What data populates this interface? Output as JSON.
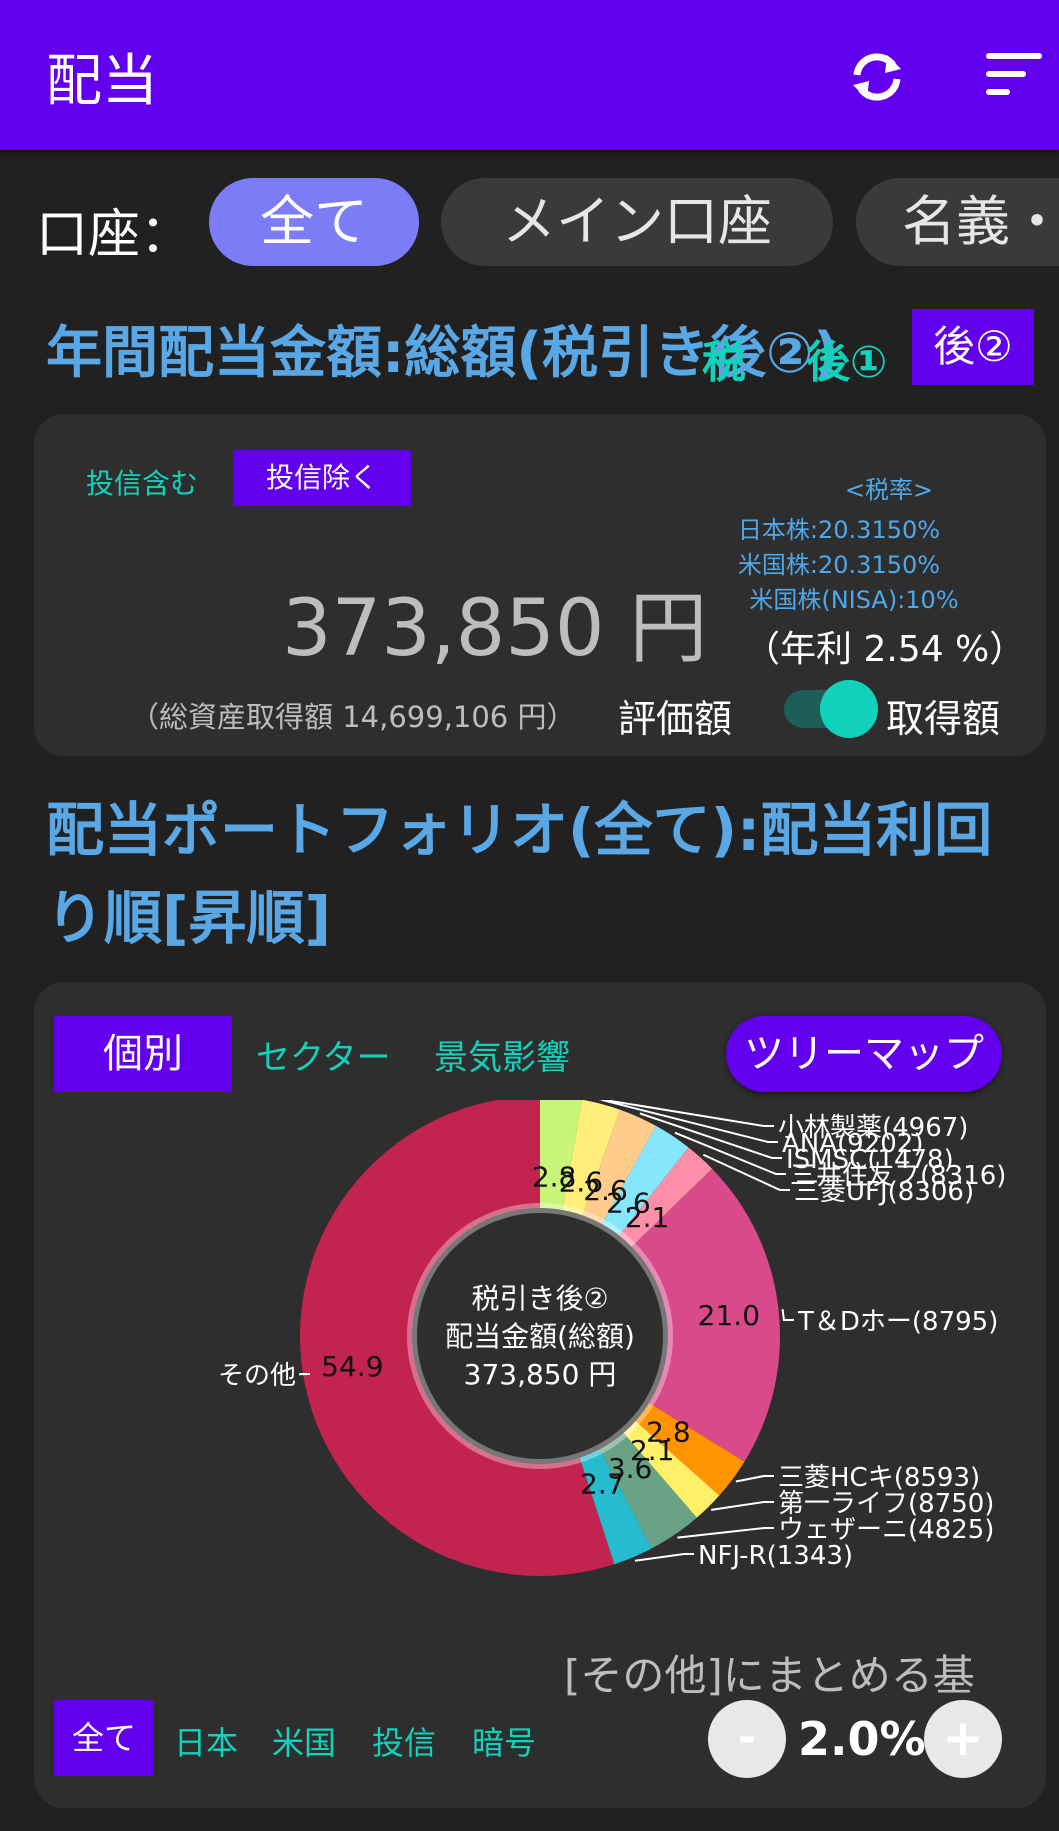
{
  "appbar": {
    "title": "配当",
    "refresh_icon": "refresh-icon",
    "sort_icon": "sort-icon"
  },
  "accounts": {
    "label": "口座：",
    "chips": [
      "全て",
      "メイン口座",
      "名義・"
    ]
  },
  "annual": {
    "title": "年間配当金額:総額(税引き後②)",
    "overlay_text": "税",
    "overlay_text2": "後①",
    "badge": "後②",
    "toggle_include": "投信含む",
    "toggle_exclude": "投信除く",
    "tax_header": "<税率>",
    "tax_jp": "日本株:20.3150%",
    "tax_us": "米国株:20.3150%",
    "tax_nisa": "米国株(NISA):10%",
    "amount": "373,850 円",
    "yield": "（年利 2.54 %）",
    "total_cost": "（総資産取得額 14,699,106 円）",
    "switch_left": "評価額",
    "switch_right": "取得額",
    "switch_on": true
  },
  "portfolio": {
    "title_line1": "配当ポートフォリオ(全て):配当利回",
    "title_line2": "り順[昇順]",
    "tabs": [
      "個別",
      "セクター",
      "景気影響"
    ],
    "treemap_button": "ツリーマップ",
    "center_line1": "税引き後②",
    "center_line2": "配当金額(総額)",
    "center_line3": "373,850 円",
    "group_label": "[その他]にまとめる基",
    "filters": [
      "全て",
      "日本",
      "米国",
      "投信",
      "暗号"
    ],
    "threshold": "2.0%",
    "minus": "-",
    "plus": "+"
  },
  "chart_data": {
    "type": "pie",
    "donut": true,
    "slices": [
      {
        "name": "小林製薬(4967)",
        "value": 2.8,
        "label": "2.8",
        "color": "#c6f57a"
      },
      {
        "name": "ANA(9202)",
        "value": 2.6,
        "label": "2.6",
        "color": "#ffef7a"
      },
      {
        "name": "ISMSC(1478)",
        "value": 2.6,
        "label": "2.6",
        "color": "#ffcc8c"
      },
      {
        "name": "三井住友フ(8316)",
        "value": 2.6,
        "label": "2.6",
        "color": "#86e6fb"
      },
      {
        "name": "三菱UFJ(8306)",
        "value": 2.1,
        "label": "2.1",
        "color": "#ff8fa8"
      },
      {
        "name": "T＆Dホー(8795)",
        "value": 21.0,
        "label": "21.0",
        "color": "#d94a8a"
      },
      {
        "name": "三菱HCキ(8593)",
        "value": 2.8,
        "label": "2.8",
        "color": "#ff9300"
      },
      {
        "name": "第一ライフ(8750)",
        "value": 2.1,
        "label": "2.1",
        "color": "#fff06a"
      },
      {
        "name": "ウェザーニ(4825)",
        "value": 3.6,
        "label": "3.6",
        "color": "#6aa286"
      },
      {
        "name": "NFJ-R(1343)",
        "value": 2.7,
        "label": "2.7",
        "color": "#25bcd0"
      },
      {
        "name": "その他",
        "value": 54.9,
        "label": "54.9",
        "color": "#c2244f"
      }
    ]
  }
}
